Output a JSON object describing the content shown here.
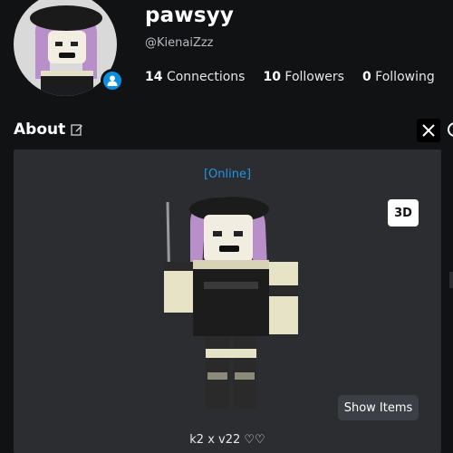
{
  "profile": {
    "display_name": "pawsyy",
    "username": "@KienaiZzz",
    "stats": [
      {
        "count": "14",
        "label": "Connections"
      },
      {
        "count": "10",
        "label": "Followers"
      },
      {
        "count": "0",
        "label": "Following"
      }
    ]
  },
  "about": {
    "title": "About",
    "status": "[Online]",
    "view_toggle_label": "3D",
    "show_items_label": "Show Items",
    "bio": "k2 x v22 ♡♡"
  },
  "icons": {
    "edit": "edit-icon",
    "x": "x-logo-icon",
    "online_badge": "online-person-icon"
  },
  "colors": {
    "background": "#111214",
    "panel": "#2b2d31",
    "status_blue": "#1f96e6",
    "badge_blue": "#0c8ee0"
  }
}
